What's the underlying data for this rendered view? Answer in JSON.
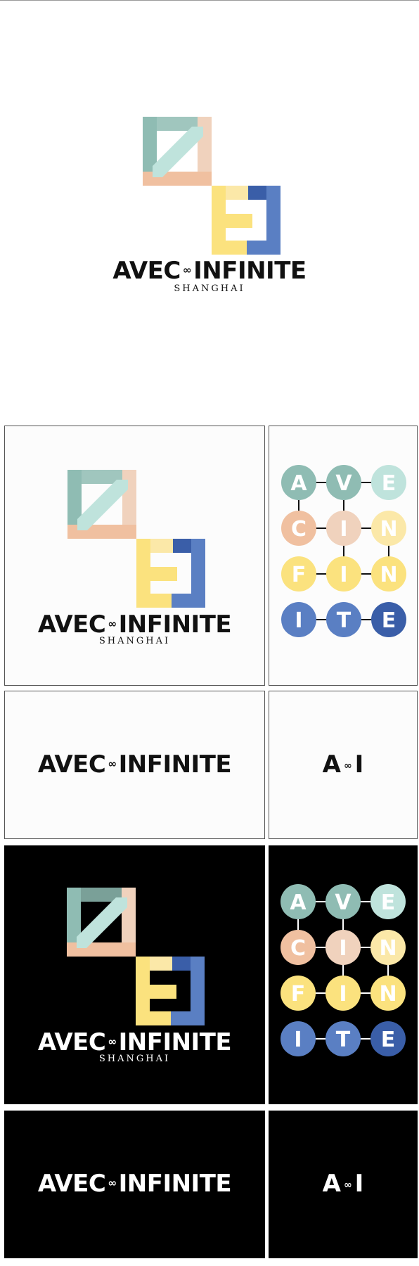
{
  "brand": {
    "name_left": "AVEC",
    "name_link": "∞",
    "name_right": "INFINITE",
    "location": "SHANGHAI",
    "monogram_left": "A",
    "monogram_right": "I"
  },
  "letter_grid": [
    [
      "A",
      "V",
      "E"
    ],
    [
      "C",
      "I",
      "N"
    ],
    [
      "F",
      "I",
      "N"
    ],
    [
      "I",
      "T",
      "E"
    ]
  ],
  "colors": {
    "teal": "#8fbcb3",
    "mint": "#bfe3dc",
    "peach": "#f0c0a0",
    "blush": "#f0d2bd",
    "cream": "#fbe8a8",
    "yellow": "#fbe27e",
    "blue": "#5a7fc3",
    "navy": "#3a5ea8",
    "ink": "#111111",
    "light_bg": "#fcfcfc",
    "dark_bg": "#000000"
  },
  "icons": [
    "logo-mark-icon",
    "infinity-link-icon",
    "letter-grid-icon"
  ]
}
